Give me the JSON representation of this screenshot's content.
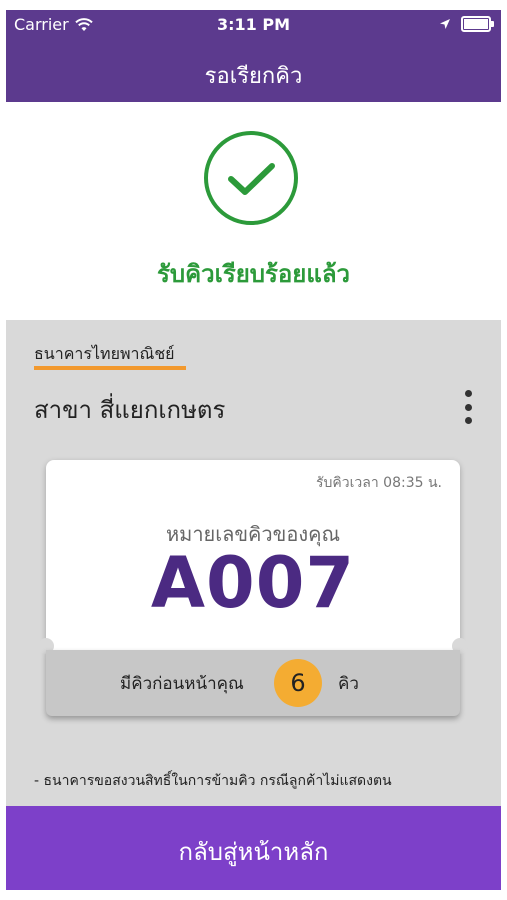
{
  "status_bar": {
    "carrier": "Carrier",
    "time": "3:11 PM",
    "wifi_icon": "wifi-icon",
    "location_icon": "location-arrow-icon",
    "battery_icon": "battery-icon"
  },
  "nav": {
    "title": "รอเรียกคิว"
  },
  "success": {
    "icon": "check-circle-icon",
    "message": "รับคิวเรียบร้อยแล้ว",
    "color": "#2c9a3a"
  },
  "bank": {
    "name": "ธนาคารไทยพาณิชย์",
    "branch": "สาขา สี่แยกเกษตร",
    "menu_icon": "more-vertical-icon"
  },
  "ticket": {
    "time_label": "รับคิวเวลา 08:35 น.",
    "queue_label": "หมายเลขคิวของคุณ",
    "queue_number": "A007"
  },
  "ahead": {
    "left_label": "มีคิวก่อนหน้าคุณ",
    "count": "6",
    "right_label": "คิว"
  },
  "note": "- ธนาคารขอสงวนสิทธิ์ในการข้ามคิว กรณีลูกค้าไม่แสดงตน",
  "bottom_button": {
    "label": "กลับสู่หน้าหลัก"
  },
  "colors": {
    "header": "#5c3a8e",
    "button": "#7d40c9",
    "accent": "#f2992e",
    "badge": "#f4ac32",
    "queue_number": "#4b2a82"
  }
}
